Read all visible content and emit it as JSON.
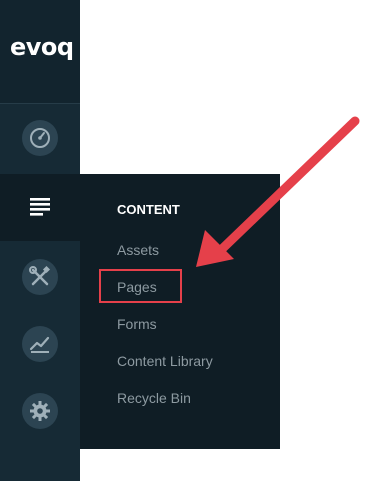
{
  "logo": {
    "text": "evoq"
  },
  "sidebar": {
    "items": [
      {
        "icon": "dashboard-icon"
      },
      {
        "icon": "pages-icon",
        "active": true
      },
      {
        "icon": "tools-icon"
      },
      {
        "icon": "analytics-icon"
      },
      {
        "icon": "gear-icon"
      }
    ]
  },
  "flyout": {
    "title": "CONTENT",
    "items": [
      {
        "label": "Assets"
      },
      {
        "label": "Pages"
      },
      {
        "label": "Forms"
      },
      {
        "label": "Content Library"
      },
      {
        "label": "Recycle Bin"
      }
    ]
  },
  "colors": {
    "sidebar_bg": "#162a35",
    "flyout_bg": "#0f1d25",
    "highlight": "#e5404a",
    "arrow": "#e5404a"
  }
}
